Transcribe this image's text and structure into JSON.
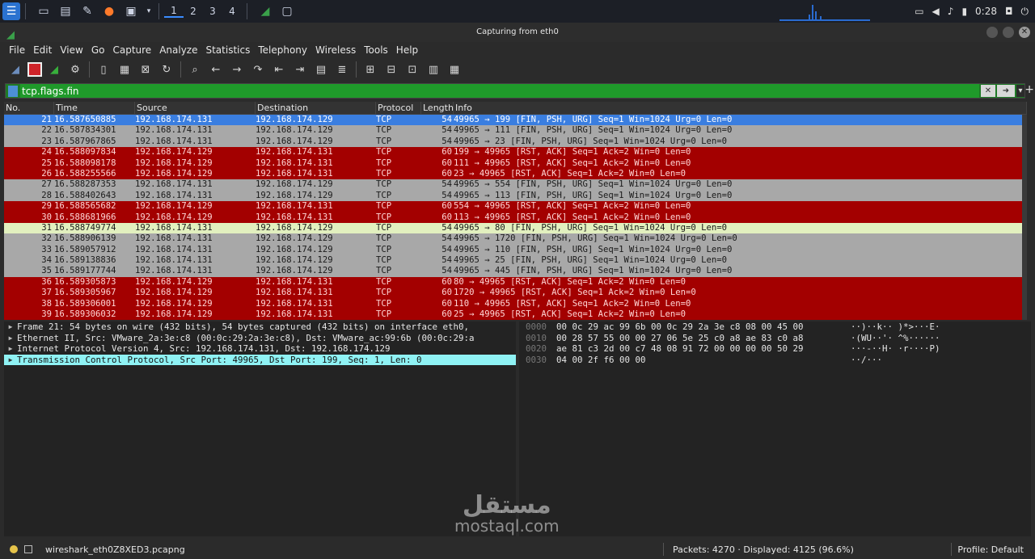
{
  "taskbar": {
    "workspaces": [
      "1",
      "2",
      "3",
      "4"
    ],
    "clock": "0:28"
  },
  "window": {
    "title": "Capturing from eth0"
  },
  "menu": [
    "File",
    "Edit",
    "View",
    "Go",
    "Capture",
    "Analyze",
    "Statistics",
    "Telephony",
    "Wireless",
    "Tools",
    "Help"
  ],
  "filter": {
    "value": "tcp.flags.fin"
  },
  "packet_list": {
    "columns": [
      "No.",
      "Time",
      "Source",
      "Destination",
      "Protocol",
      "Length",
      "Info"
    ],
    "rows": [
      {
        "no": "21",
        "time": "16.587650885",
        "src": "192.168.174.131",
        "dst": "192.168.174.129",
        "proto": "TCP",
        "len": "54",
        "info": "49965 → 199 [FIN, PSH, URG] Seq=1 Win=1024 Urg=0 Len=0",
        "style": "sel"
      },
      {
        "no": "22",
        "time": "16.587834301",
        "src": "192.168.174.131",
        "dst": "192.168.174.129",
        "proto": "TCP",
        "len": "54",
        "info": "49965 → 111 [FIN, PSH, URG] Seq=1 Win=1024 Urg=0 Len=0",
        "style": "fin"
      },
      {
        "no": "23",
        "time": "16.587967865",
        "src": "192.168.174.131",
        "dst": "192.168.174.129",
        "proto": "TCP",
        "len": "54",
        "info": "49965 → 23 [FIN, PSH, URG] Seq=1 Win=1024 Urg=0 Len=0",
        "style": "fin"
      },
      {
        "no": "24",
        "time": "16.588097834",
        "src": "192.168.174.129",
        "dst": "192.168.174.131",
        "proto": "TCP",
        "len": "60",
        "info": "199 → 49965 [RST, ACK] Seq=1 Ack=2 Win=0 Len=0",
        "style": "rst"
      },
      {
        "no": "25",
        "time": "16.588098178",
        "src": "192.168.174.129",
        "dst": "192.168.174.131",
        "proto": "TCP",
        "len": "60",
        "info": "111 → 49965 [RST, ACK] Seq=1 Ack=2 Win=0 Len=0",
        "style": "rst"
      },
      {
        "no": "26",
        "time": "16.588255566",
        "src": "192.168.174.129",
        "dst": "192.168.174.131",
        "proto": "TCP",
        "len": "60",
        "info": "23 → 49965 [RST, ACK] Seq=1 Ack=2 Win=0 Len=0",
        "style": "rst"
      },
      {
        "no": "27",
        "time": "16.588287353",
        "src": "192.168.174.131",
        "dst": "192.168.174.129",
        "proto": "TCP",
        "len": "54",
        "info": "49965 → 554 [FIN, PSH, URG] Seq=1 Win=1024 Urg=0 Len=0",
        "style": "fin"
      },
      {
        "no": "28",
        "time": "16.588402643",
        "src": "192.168.174.131",
        "dst": "192.168.174.129",
        "proto": "TCP",
        "len": "54",
        "info": "49965 → 113 [FIN, PSH, URG] Seq=1 Win=1024 Urg=0 Len=0",
        "style": "fin"
      },
      {
        "no": "29",
        "time": "16.588565682",
        "src": "192.168.174.129",
        "dst": "192.168.174.131",
        "proto": "TCP",
        "len": "60",
        "info": "554 → 49965 [RST, ACK] Seq=1 Ack=2 Win=0 Len=0",
        "style": "rst"
      },
      {
        "no": "30",
        "time": "16.588681966",
        "src": "192.168.174.129",
        "dst": "192.168.174.131",
        "proto": "TCP",
        "len": "60",
        "info": "113 → 49965 [RST, ACK] Seq=1 Ack=2 Win=0 Len=0",
        "style": "rst"
      },
      {
        "no": "31",
        "time": "16.588749774",
        "src": "192.168.174.131",
        "dst": "192.168.174.129",
        "proto": "TCP",
        "len": "54",
        "info": "49965 → 80 [FIN, PSH, URG] Seq=1 Win=1024 Urg=0 Len=0",
        "style": "http"
      },
      {
        "no": "32",
        "time": "16.588906139",
        "src": "192.168.174.131",
        "dst": "192.168.174.129",
        "proto": "TCP",
        "len": "54",
        "info": "49965 → 1720 [FIN, PSH, URG] Seq=1 Win=1024 Urg=0 Len=0",
        "style": "fin"
      },
      {
        "no": "33",
        "time": "16.589057912",
        "src": "192.168.174.131",
        "dst": "192.168.174.129",
        "proto": "TCP",
        "len": "54",
        "info": "49965 → 110 [FIN, PSH, URG] Seq=1 Win=1024 Urg=0 Len=0",
        "style": "fin"
      },
      {
        "no": "34",
        "time": "16.589138836",
        "src": "192.168.174.131",
        "dst": "192.168.174.129",
        "proto": "TCP",
        "len": "54",
        "info": "49965 → 25 [FIN, PSH, URG] Seq=1 Win=1024 Urg=0 Len=0",
        "style": "fin"
      },
      {
        "no": "35",
        "time": "16.589177744",
        "src": "192.168.174.131",
        "dst": "192.168.174.129",
        "proto": "TCP",
        "len": "54",
        "info": "49965 → 445 [FIN, PSH, URG] Seq=1 Win=1024 Urg=0 Len=0",
        "style": "fin"
      },
      {
        "no": "36",
        "time": "16.589305873",
        "src": "192.168.174.129",
        "dst": "192.168.174.131",
        "proto": "TCP",
        "len": "60",
        "info": "80 → 49965 [RST, ACK] Seq=1 Ack=2 Win=0 Len=0",
        "style": "rst"
      },
      {
        "no": "37",
        "time": "16.589305967",
        "src": "192.168.174.129",
        "dst": "192.168.174.131",
        "proto": "TCP",
        "len": "60",
        "info": "1720 → 49965 [RST, ACK] Seq=1 Ack=2 Win=0 Len=0",
        "style": "rst"
      },
      {
        "no": "38",
        "time": "16.589306001",
        "src": "192.168.174.129",
        "dst": "192.168.174.131",
        "proto": "TCP",
        "len": "60",
        "info": "110 → 49965 [RST, ACK] Seq=1 Ack=2 Win=0 Len=0",
        "style": "rst"
      },
      {
        "no": "39",
        "time": "16.589306032",
        "src": "192.168.174.129",
        "dst": "192.168.174.131",
        "proto": "TCP",
        "len": "60",
        "info": "25 → 49965 [RST, ACK] Seq=1 Ack=2 Win=0 Len=0",
        "style": "rst"
      }
    ]
  },
  "details": [
    {
      "text": "Frame 21: 54 bytes on wire (432 bits), 54 bytes captured (432 bits) on interface eth0,",
      "selected": false
    },
    {
      "text": "Ethernet II, Src: VMware_2a:3e:c8 (00:0c:29:2a:3e:c8), Dst: VMware_ac:99:6b (00:0c:29:a",
      "selected": false
    },
    {
      "text": "Internet Protocol Version 4, Src: 192.168.174.131, Dst: 192.168.174.129",
      "selected": false
    },
    {
      "text": "Transmission Control Protocol, Src Port: 49965, Dst Port: 199, Seq: 1, Len: 0",
      "selected": true
    }
  ],
  "bytes": [
    {
      "offset": "0000",
      "hex": "00 0c 29 ac 99 6b 00 0c  29 2a 3e c8 08 00 45 00",
      "ascii": "··)··k·· )*>···E·"
    },
    {
      "offset": "0010",
      "hex": "00 28 57 55 00 00 27 06  5e 25 c0 a8 ae 83 c0 a8",
      "ascii": "·(WU··'· ^%······"
    },
    {
      "offset": "0020",
      "hex": "ae 81 c3 2d 00 c7 48 08  91 72 00 00 00 00 50 29",
      "ascii": "···-··H· ·r····P)"
    },
    {
      "offset": "0030",
      "hex": "04 00 2f f6 00 00",
      "ascii": "··/···"
    }
  ],
  "status": {
    "file": "wireshark_eth0Z8XED3.pcapng",
    "packets": "Packets: 4270 · Displayed: 4125 (96.6%)",
    "profile": "Profile: Default"
  },
  "watermark": {
    "arabic": "مستقل",
    "latin": "mostaql.com"
  }
}
